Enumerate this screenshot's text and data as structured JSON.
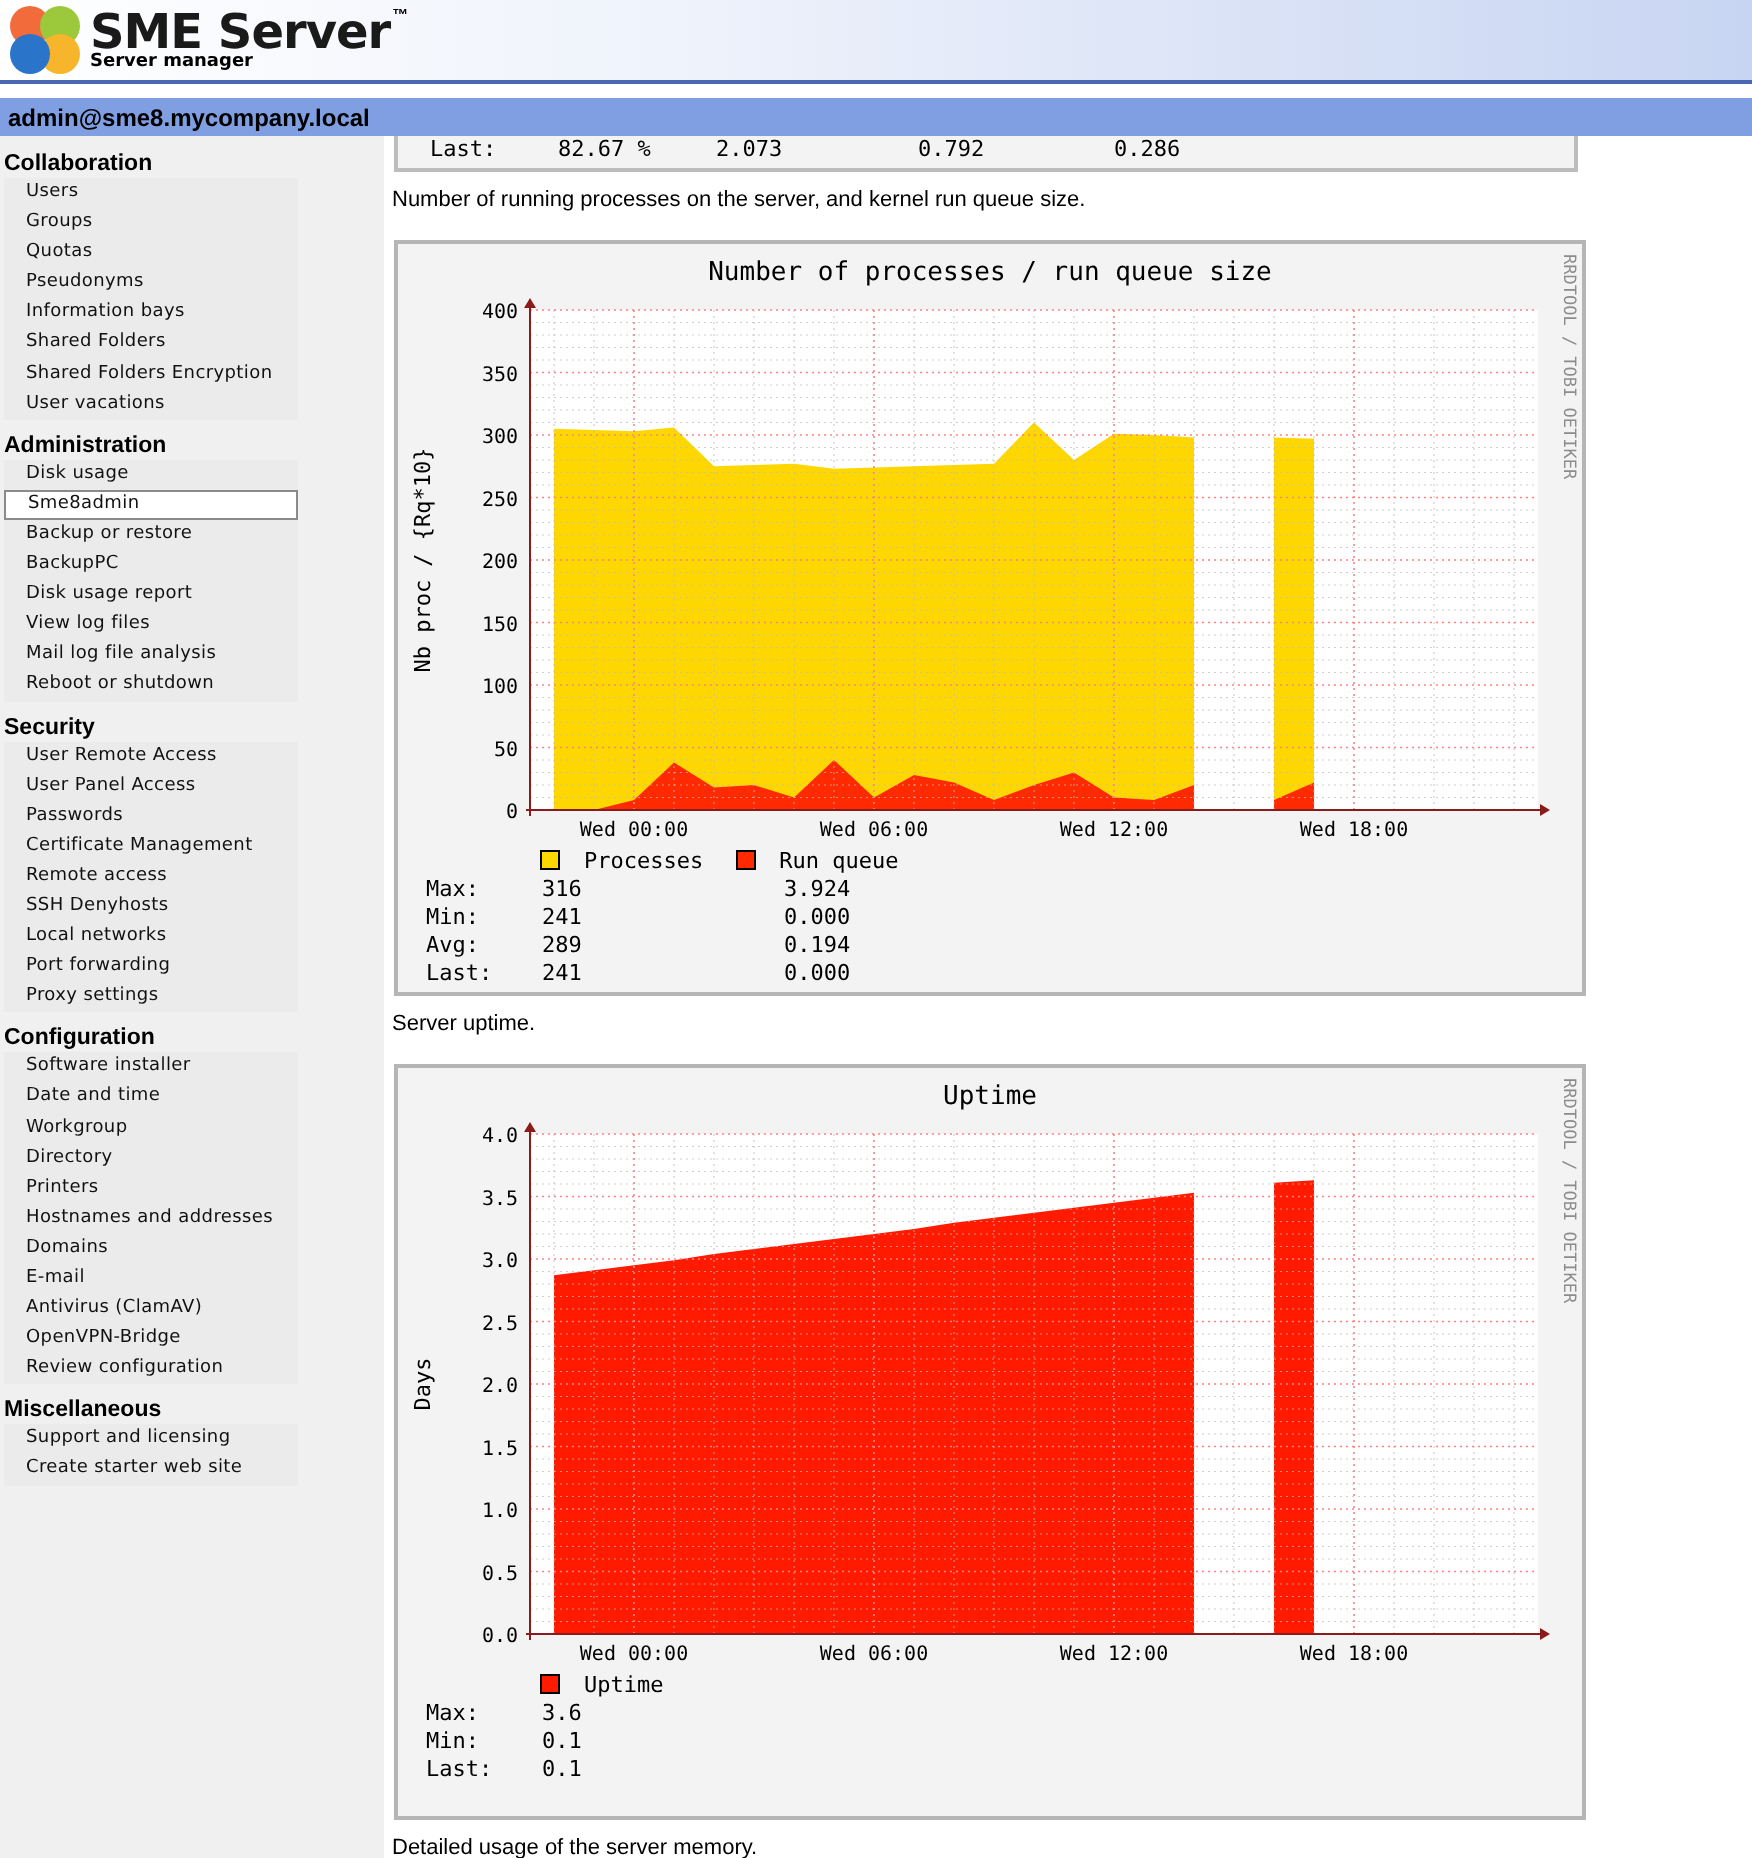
{
  "header": {
    "logo_title": "SME Server",
    "trademark": "™",
    "subtitle": "Server manager"
  },
  "user_bar": "admin@sme8.mycompany.local",
  "sidebar": {
    "sections": [
      {
        "title": "Collaboration",
        "items": [
          {
            "label": "Users",
            "selected": false
          },
          {
            "label": "Groups",
            "selected": false
          },
          {
            "label": "Quotas",
            "selected": false
          },
          {
            "label": "Pseudonyms",
            "selected": false
          },
          {
            "label": "Information bays",
            "selected": false
          },
          {
            "label": "Shared Folders",
            "selected": false
          },
          {
            "label": "Shared Folders Encryption",
            "selected": false
          },
          {
            "label": "User vacations",
            "selected": false
          }
        ]
      },
      {
        "title": "Administration",
        "items": [
          {
            "label": "Disk usage",
            "selected": false
          },
          {
            "label": "Sme8admin",
            "selected": true
          },
          {
            "label": "Backup or restore",
            "selected": false
          },
          {
            "label": "BackupPC",
            "selected": false
          },
          {
            "label": "Disk usage report",
            "selected": false
          },
          {
            "label": "View log files",
            "selected": false
          },
          {
            "label": "Mail log file analysis",
            "selected": false
          },
          {
            "label": "Reboot or shutdown",
            "selected": false
          }
        ]
      },
      {
        "title": "Security",
        "items": [
          {
            "label": "User Remote Access",
            "selected": false
          },
          {
            "label": "User Panel Access",
            "selected": false
          },
          {
            "label": "Passwords",
            "selected": false
          },
          {
            "label": "Certificate Management",
            "selected": false
          },
          {
            "label": "Remote access",
            "selected": false
          },
          {
            "label": "SSH Denyhosts",
            "selected": false
          },
          {
            "label": "Local networks",
            "selected": false
          },
          {
            "label": "Port forwarding",
            "selected": false
          },
          {
            "label": "Proxy settings",
            "selected": false
          }
        ]
      },
      {
        "title": "Configuration",
        "items": [
          {
            "label": "Software installer",
            "selected": false
          },
          {
            "label": "Date and time",
            "selected": false
          },
          {
            "label": "Workgroup",
            "selected": false
          },
          {
            "label": "Directory",
            "selected": false
          },
          {
            "label": "Printers",
            "selected": false
          },
          {
            "label": "Hostnames and addresses",
            "selected": false
          },
          {
            "label": "Domains",
            "selected": false
          },
          {
            "label": "E-mail",
            "selected": false
          },
          {
            "label": "Antivirus (ClamAV)",
            "selected": false
          },
          {
            "label": "OpenVPN-Bridge",
            "selected": false
          },
          {
            "label": "Review configuration",
            "selected": false
          }
        ]
      },
      {
        "title": "Miscellaneous",
        "items": [
          {
            "label": "Support and licensing",
            "selected": false
          },
          {
            "label": "Create starter web site",
            "selected": false
          }
        ]
      }
    ]
  },
  "content": [
    {
      "kind": "stats_fragment",
      "rows": [
        {
          "label": "Last:",
          "values": [
            "82.67 %",
            "2.073",
            "0.792",
            "0.286"
          ]
        }
      ]
    },
    {
      "kind": "caption",
      "text": "Number of running processes on the server, and kernel run queue size."
    },
    {
      "kind": "chart",
      "side_text": "RRDTOOL / TOBI OETIKER",
      "chart_data": {
        "type": "area",
        "title": "Number of processes / run queue size",
        "ylabel": "Nb proc / {Rq*10}",
        "categories": [
          null,
          null,
          "Wed 00:00",
          null,
          null,
          null,
          null,
          null,
          "Wed 06:00",
          null,
          null,
          null,
          null,
          null,
          "Wed 12:00",
          null,
          null,
          null,
          null,
          null,
          "Wed 18:00",
          null,
          null,
          null,
          null
        ],
        "series": [
          {
            "name": "Processes",
            "color": "#ffd700",
            "values": [
              305,
              304,
              303,
              306,
              275,
              276,
              277,
              273,
              274,
              275,
              276,
              277,
              310,
              280,
              301,
              300,
              298,
              null,
              298,
              297,
              null,
              null,
              null,
              null,
              null
            ]
          },
          {
            "name": "Run queue",
            "color": "#ff2a00",
            "values": [
              0,
              0,
              8,
              38,
              18,
              20,
              10,
              40,
              10,
              28,
              22,
              8,
              20,
              30,
              10,
              8,
              20,
              null,
              8,
              22,
              null,
              null,
              null,
              null,
              null
            ]
          }
        ],
        "ylim": [
          0,
          400
        ],
        "grid": true,
        "yticks": [
          0,
          50,
          100,
          150,
          200,
          250,
          300,
          350,
          400
        ]
      },
      "stats": [
        {
          "label": "Max:",
          "values": [
            "316",
            "3.924"
          ]
        },
        {
          "label": "Min:",
          "values": [
            "241",
            "0.000"
          ]
        },
        {
          "label": "Avg:",
          "values": [
            "289",
            "0.194"
          ]
        },
        {
          "label": "Last:",
          "values": [
            "241",
            "0.000"
          ]
        }
      ]
    },
    {
      "kind": "caption",
      "text": "Server uptime."
    },
    {
      "kind": "chart",
      "side_text": "RRDTOOL / TOBI OETIKER",
      "chart_data": {
        "type": "area",
        "title": "Uptime",
        "ylabel": "Days",
        "categories": [
          null,
          null,
          "Wed 00:00",
          null,
          null,
          null,
          null,
          null,
          "Wed 06:00",
          null,
          null,
          null,
          null,
          null,
          "Wed 12:00",
          null,
          null,
          null,
          null,
          null,
          "Wed 18:00",
          null,
          null,
          null,
          null
        ],
        "series": [
          {
            "name": "Uptime",
            "color": "#ff1a00",
            "values": [
              2.87,
              2.91,
              2.95,
              2.99,
              3.04,
              3.08,
              3.12,
              3.16,
              3.2,
              3.24,
              3.29,
              3.33,
              3.37,
              3.41,
              3.45,
              3.49,
              3.53,
              null,
              3.61,
              3.63,
              null,
              null,
              null,
              null,
              null
            ]
          }
        ],
        "ylim": [
          0,
          4
        ],
        "grid": true,
        "yticks": [
          {
            "value": 0,
            "label": "0.0"
          },
          {
            "value": 0.5,
            "label": "0.5"
          },
          {
            "value": 1,
            "label": "1.0"
          },
          {
            "value": 1.5,
            "label": "1.5"
          },
          {
            "value": 2,
            "label": "2.0"
          },
          {
            "value": 2.5,
            "label": "2.5"
          },
          {
            "value": 3,
            "label": "3.0"
          },
          {
            "value": 3.5,
            "label": "3.5"
          },
          {
            "value": 4,
            "label": "4.0"
          }
        ]
      },
      "stats": [
        {
          "label": "Max:",
          "values": [
            "3.6"
          ]
        },
        {
          "label": "Min:",
          "values": [
            "0.1"
          ]
        },
        {
          "label": "Last:",
          "values": [
            "0.1"
          ]
        }
      ]
    },
    {
      "kind": "caption",
      "text": "Detailed usage of the server memory."
    }
  ]
}
